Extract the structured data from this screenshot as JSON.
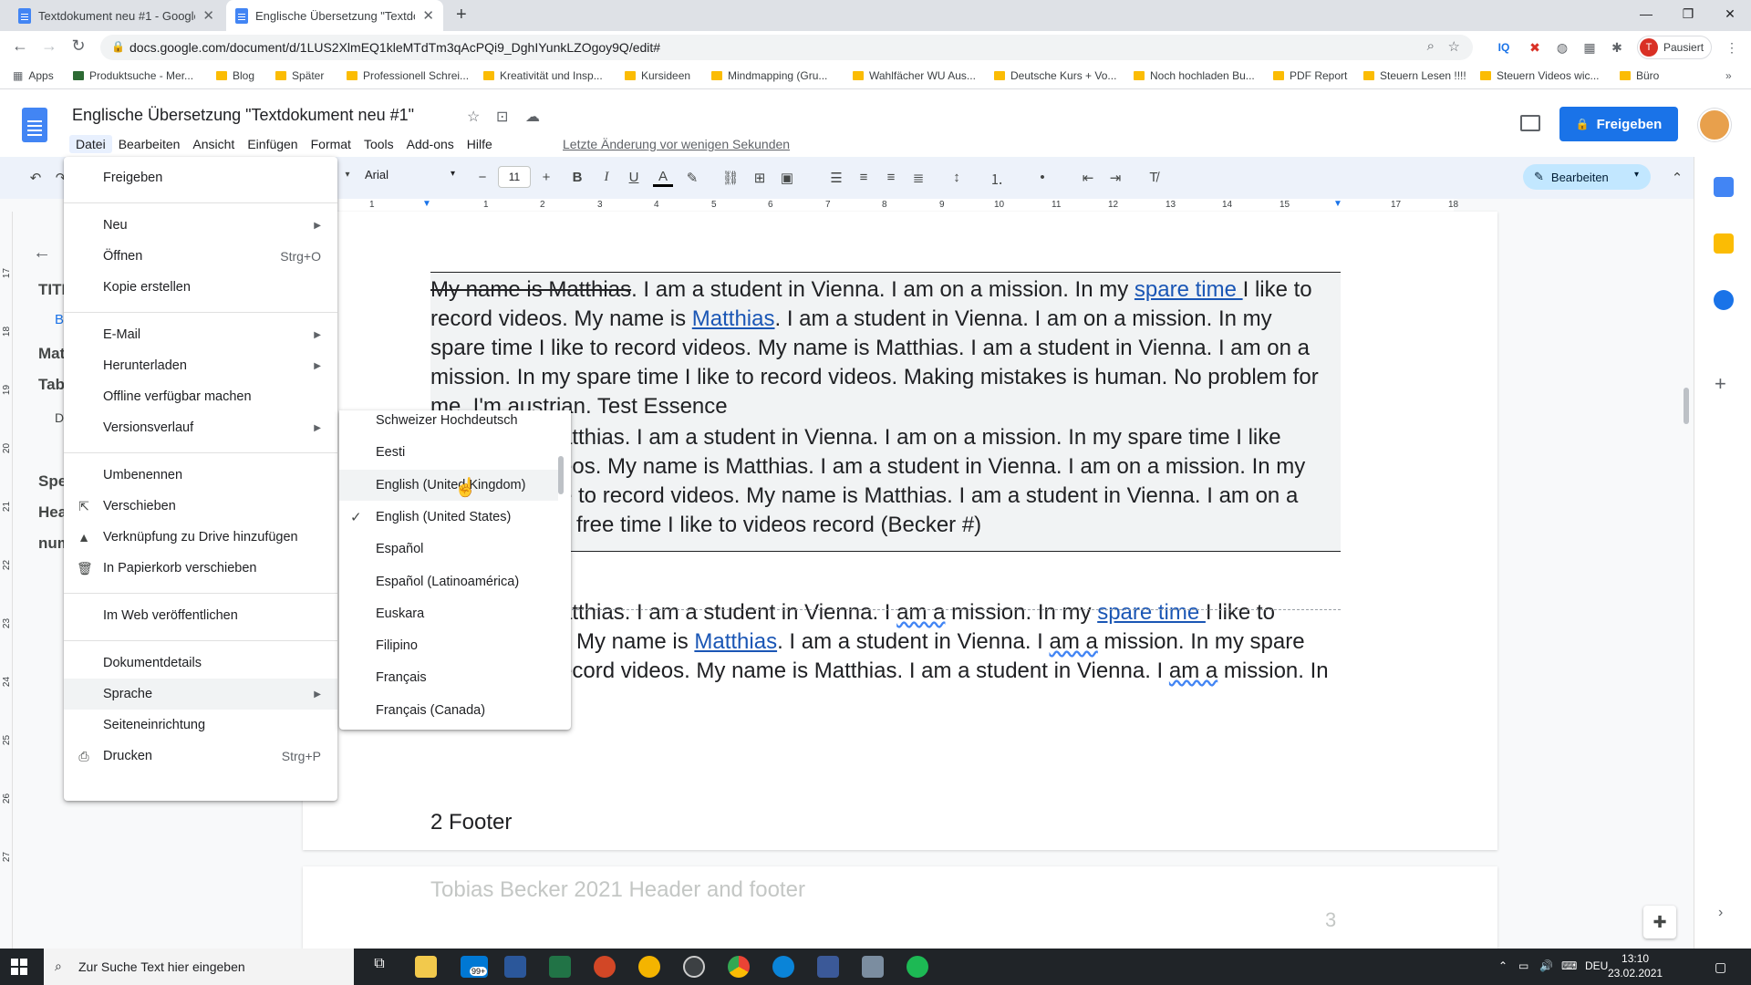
{
  "browser": {
    "tabs": [
      {
        "title": "Textdokument neu #1 - Google D",
        "active": false
      },
      {
        "title": "Englische Übersetzung \"Textdoku",
        "active": true
      }
    ],
    "url": "docs.google.com/document/d/1LUS2XlmEQ1kleMTdTm3qAcPQi9_DghIYunkLZOgoy9Q/edit#",
    "profile_label": "Pausiert",
    "profile_initial": "T",
    "bookmarks": [
      "Apps",
      "Produktsuche - Mer...",
      "Blog",
      "Später",
      "Professionell Schrei...",
      "Kreativität und Insp...",
      "Kursideen",
      "Mindmapping  (Gru...",
      "Wahlfächer WU Aus...",
      "Deutsche Kurs + Vo...",
      "Noch hochladen Bu...",
      "PDF Report",
      "Steuern Lesen !!!!",
      "Steuern Videos wic...",
      "Büro"
    ]
  },
  "docs": {
    "title": "Englische Übersetzung \"Textdokument neu #1\"",
    "menus": [
      "Datei",
      "Bearbeiten",
      "Ansicht",
      "Einfügen",
      "Format",
      "Tools",
      "Add-ons",
      "Hilfe"
    ],
    "last_edit": "Letzte Änderung vor wenigen Sekunden",
    "share_label": "Freigeben",
    "font": "Arial",
    "font_size": "11",
    "edit_mode": "Bearbeiten",
    "ruler_numbers": [
      "1",
      "1",
      "2",
      "3",
      "4",
      "5",
      "6",
      "7",
      "8",
      "9",
      "10",
      "11",
      "12",
      "13",
      "14",
      "15",
      "16",
      "17",
      "18"
    ],
    "vruler_numbers": [
      "17",
      "18",
      "19",
      "20",
      "21",
      "22",
      "23",
      "24",
      "25",
      "26",
      "27"
    ]
  },
  "outline": {
    "items": [
      "TITL",
      "B",
      "Mat",
      "Tab",
      "D",
      "Spe",
      "Hea",
      "num"
    ]
  },
  "document": {
    "lines": [
      {
        "parts": [
          {
            "t": "My name is Matthias",
            "s": "strike"
          },
          {
            "t": ". I am a student in Vienna. I am on a mission. In my "
          },
          {
            "t": "spare time ",
            "s": "link"
          },
          {
            "t": "I like to"
          }
        ]
      },
      {
        "parts": [
          {
            "t": "record videos. My name is "
          },
          {
            "t": "Matthias",
            "s": "link"
          },
          {
            "t": ". I am a student in Vienna. I am on a mission. In my"
          }
        ]
      },
      {
        "parts": [
          {
            "t": "spare time I like to record videos. My name is Matthias. I am a student in Vienna. I am on a"
          }
        ]
      },
      {
        "parts": [
          {
            "t": "mission. In my spare time I like to record videos. Making mistakes is human. No problem for"
          }
        ]
      },
      {
        "parts": [
          {
            "t": "me. I'm austrian. Test Essence"
          }
        ]
      },
      {
        "parts": [
          {
            "t": "atthias. I am a student in Vienna. I am on a mission. In my spare time I like"
          }
        ]
      },
      {
        "parts": [
          {
            "t": "eos. My name is Matthias. I am a student in Vienna. I am on a mission. In my"
          }
        ]
      },
      {
        "parts": [
          {
            "t": "e to record videos. My name is Matthias. I am a student in Vienna. I am on a"
          }
        ]
      },
      {
        "parts": [
          {
            "t": "free time I like to videos record (Becker #)"
          }
        ]
      },
      {
        "parts": [
          {
            "t": "atthias. I am a student in Vienna. I "
          },
          {
            "t": "am a",
            "s": "squig"
          },
          {
            "t": " mission. In my "
          },
          {
            "t": "spare time ",
            "s": "link"
          },
          {
            "t": "I like to"
          }
        ]
      },
      {
        "parts": [
          {
            "t": "My name is "
          },
          {
            "t": "Matthias",
            "s": "link"
          },
          {
            "t": ". I am a student in Vienna. I "
          },
          {
            "t": "am a",
            "s": "squig"
          },
          {
            "t": " mission. In my spare"
          }
        ]
      },
      {
        "parts": [
          {
            "t": "ecord videos. My name is Matthias. I am a student in Vienna. I "
          },
          {
            "t": "am a",
            "s": "squig"
          },
          {
            "t": " mission. In"
          }
        ]
      }
    ],
    "footer_heading": "2 Footer",
    "page2_header": "Tobias Becker 2021 Header and footer",
    "page_number": "3"
  },
  "file_menu": {
    "items": [
      {
        "label": "Freigeben"
      },
      {
        "label": "Neu",
        "arrow": true
      },
      {
        "label": "Öffnen",
        "shortcut": "Strg+O"
      },
      {
        "label": "Kopie erstellen"
      },
      {
        "label": "E-Mail",
        "arrow": true
      },
      {
        "label": "Herunterladen",
        "arrow": true
      },
      {
        "label": "Offline verfügbar machen"
      },
      {
        "label": "Versionsverlauf",
        "arrow": true
      },
      {
        "label": "Umbenennen"
      },
      {
        "label": "Verschieben"
      },
      {
        "label": "Verknüpfung zu Drive hinzufügen"
      },
      {
        "label": "In Papierkorb verschieben"
      },
      {
        "label": "Im Web veröffentlichen"
      },
      {
        "label": "Dokumentdetails"
      },
      {
        "label": "Sprache",
        "arrow": true,
        "highlight": true
      },
      {
        "label": "Seiteneinrichtung"
      },
      {
        "label": "Drucken",
        "shortcut": "Strg+P"
      }
    ]
  },
  "language_menu": {
    "items": [
      {
        "label": "Schweizer Hochdeutsch"
      },
      {
        "label": "Eesti"
      },
      {
        "label": "English (United Kingdom)",
        "hover": true
      },
      {
        "label": "English (United States)",
        "checked": true
      },
      {
        "label": "Español"
      },
      {
        "label": "Español (Latinoamérica)"
      },
      {
        "label": "Euskara"
      },
      {
        "label": "Filipino"
      },
      {
        "label": "Français"
      },
      {
        "label": "Français (Canada)"
      }
    ]
  },
  "taskbar": {
    "search_placeholder": "Zur Suche Text hier eingeben",
    "badge": "99+",
    "lang": "DEU",
    "time": "13:10",
    "date": "23.02.2021"
  },
  "colors": {
    "accent": "#1a73e8",
    "link": "#1a56b5",
    "toolbar": "#edf2fa"
  }
}
